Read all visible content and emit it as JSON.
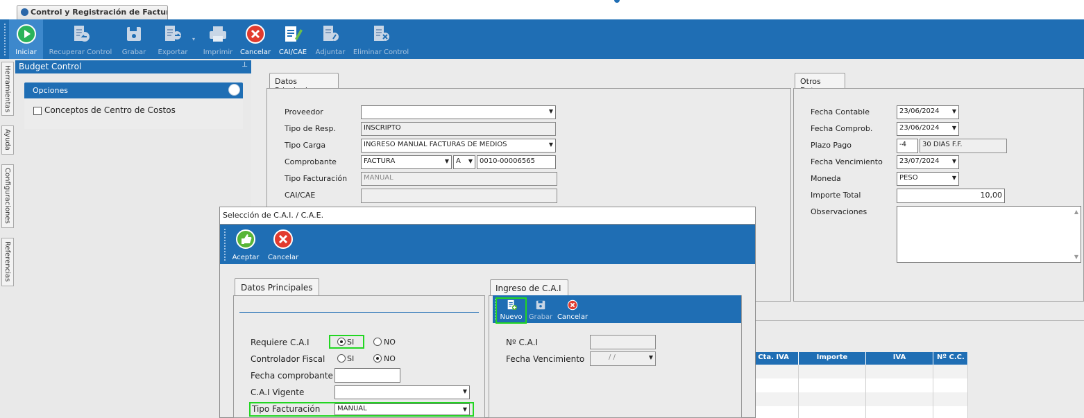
{
  "tab": {
    "title": "Control y Registración de Factura..."
  },
  "toolbar": {
    "iniciar": "Iniciar",
    "recuperar": "Recuperar Control",
    "grabar": "Grabar",
    "exportar": "Exportar",
    "imprimir": "Imprimir",
    "cancelar": "Cancelar",
    "caicae": "CAI/CAE",
    "adjuntar": "Adjuntar",
    "eliminar": "Eliminar Control"
  },
  "sidetabs": [
    "Herramientas",
    "Ayuda",
    "Configuraciones",
    "Referencias"
  ],
  "budget": {
    "title": "Budget Control",
    "pin": "p",
    "opciones": "Opciones",
    "concepto": "Conceptos de Centro de Costos"
  },
  "datos_principales": {
    "tab": "Datos Principales",
    "proveedor_label": "Proveedor",
    "proveedor_value": "",
    "tipo_resp_label": "Tipo de Resp.",
    "tipo_resp_value": "INSCRIPTO",
    "tipo_carga_label": "Tipo Carga",
    "tipo_carga_value": "INGRESO MANUAL FACTURAS DE MEDIOS",
    "comprobante_label": "Comprobante",
    "comprobante_tipo": "FACTURA",
    "comprobante_letra": "A",
    "comprobante_numero": "0010-00006565",
    "tipo_fact_label": "Tipo Facturación",
    "tipo_fact_value": "MANUAL",
    "caicae_label": "CAI/CAE",
    "caicae_value": ""
  },
  "otros_datos": {
    "tab": "Otros Datos",
    "fecha_contable_label": "Fecha Contable",
    "fecha_contable_value": "23/06/2024",
    "fecha_comprob_label": "Fecha Comprob.",
    "fecha_comprob_value": "23/06/2024",
    "plazo_pago_label": "Plazo Pago",
    "plazo_pago_code": "-4",
    "plazo_pago_desc": "30 DIAS F.F.",
    "fecha_venc_label": "Fecha Vencimiento",
    "fecha_venc_value": "23/07/2024",
    "moneda_label": "Moneda",
    "moneda_value": "PESO",
    "importe_label": "Importe Total",
    "importe_value": "10,00",
    "observaciones_label": "Observaciones"
  },
  "grid": {
    "headers": [
      "º Cta. IVA",
      "Importe",
      "IVA",
      "Nº C.C."
    ]
  },
  "modal": {
    "title": "Selección de C.A.I. / C.A.E.",
    "aceptar": "Aceptar",
    "cancelar": "Cancelar",
    "datos_tab": "Datos Principales",
    "requiere_label": "Requiere C.A.I",
    "si": "SI",
    "no": "NO",
    "controlador_label": "Controlador Fiscal",
    "fecha_comp_label": "Fecha comprobante",
    "cai_vigente_label": "C.A.I Vigente",
    "tipo_fact_label": "Tipo Facturación",
    "tipo_fact_value": "MANUAL",
    "ingreso_tab": "Ingreso de C.A.I",
    "nuevo": "Nuevo",
    "grabar": "Grabar",
    "cancelar2": "Cancelar",
    "nro_cai_label": "Nº C.A.I",
    "fecha_venc_label": "Fecha Vencimiento",
    "fecha_venc_value": "/   /"
  },
  "colors": {
    "accent": "#1f6eb4",
    "highlight": "#22d622"
  }
}
